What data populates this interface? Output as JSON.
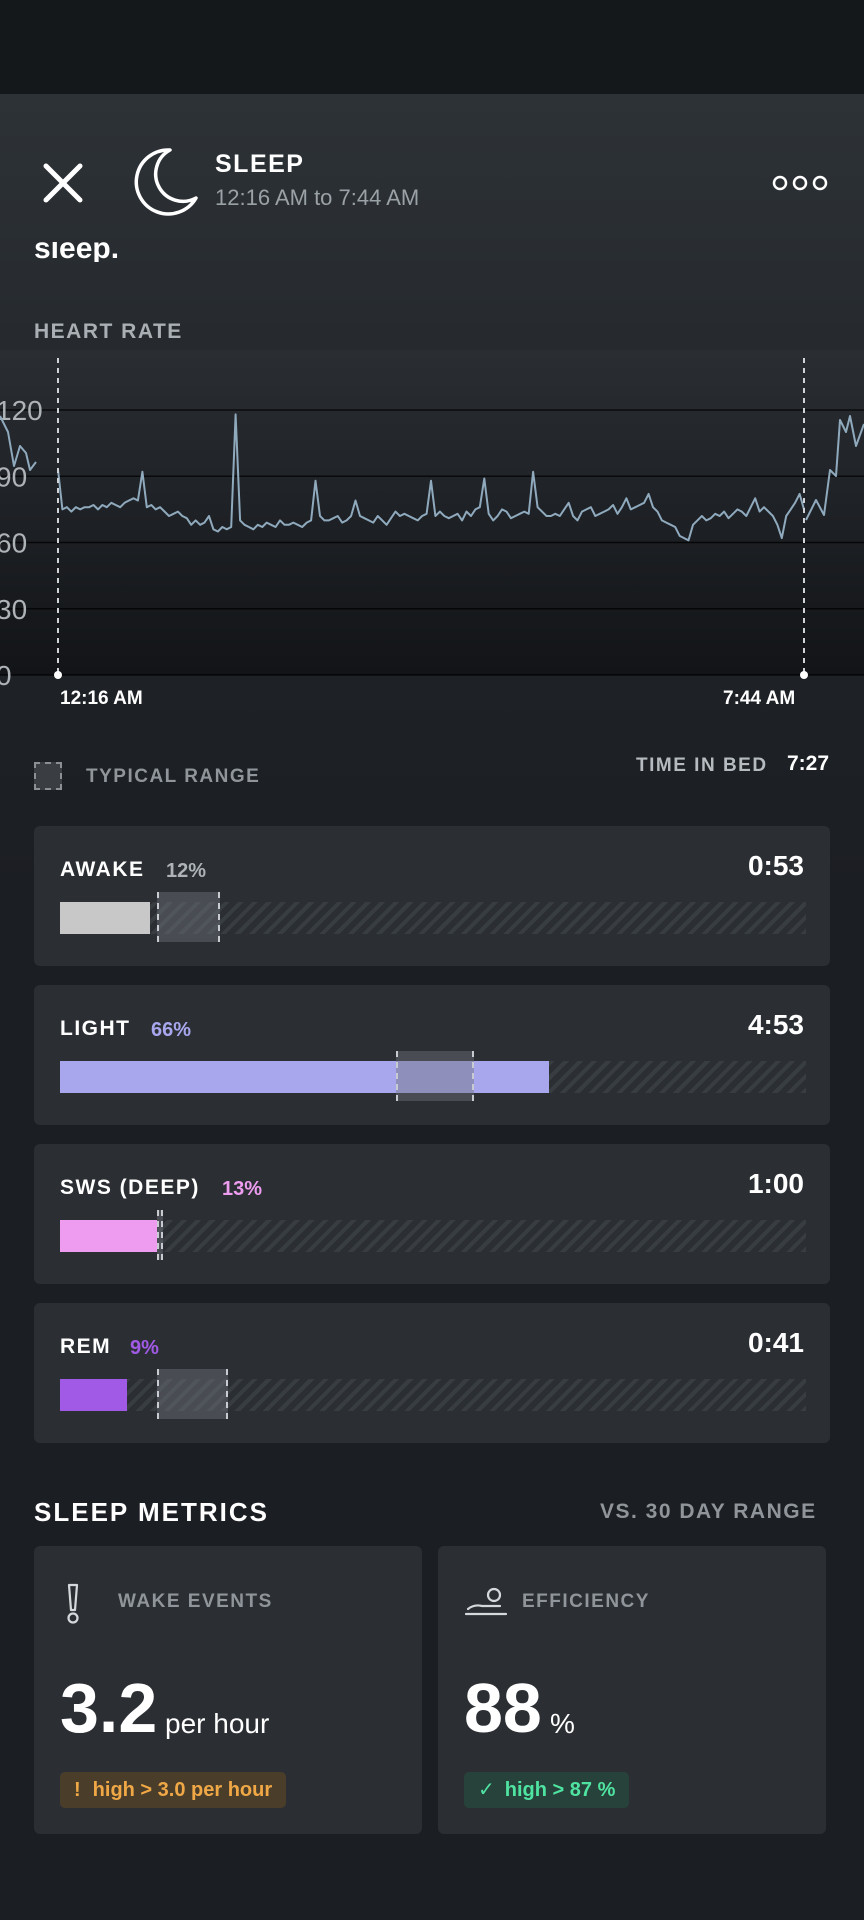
{
  "header": {
    "title": "SLEEP",
    "time_range": "12:16 AM to 7:44 AM",
    "cut_text": "sleep."
  },
  "heart_rate": {
    "label": "HEART RATE",
    "start_label": "12:16 AM",
    "end_label": "7:44 AM"
  },
  "chart_data": {
    "type": "line",
    "ylabel": "",
    "ylim": [
      0,
      120
    ],
    "y_ticks": [
      "0",
      "30",
      "60",
      "90",
      "120"
    ],
    "x_start": "12:16 AM",
    "x_end": "7:44 AM",
    "series": [
      {
        "values": [
          93,
          75,
          76,
          74,
          76,
          75,
          76,
          76,
          77,
          75,
          77,
          76,
          78,
          77,
          76,
          78,
          79,
          80,
          79,
          92,
          76,
          77,
          75,
          76,
          74,
          72,
          73,
          74,
          72,
          71,
          68,
          70,
          68,
          69,
          72,
          66,
          65,
          67,
          66,
          67,
          118,
          70,
          68,
          67,
          66,
          68,
          67,
          69,
          68,
          67,
          70,
          68,
          68,
          69,
          68,
          67,
          69,
          70,
          88,
          72,
          70,
          70,
          71,
          72,
          69,
          70,
          72,
          79,
          72,
          71,
          70,
          69,
          72,
          70,
          68,
          71,
          74,
          72,
          73,
          72,
          71,
          70,
          72,
          73,
          88,
          72,
          74,
          72,
          71,
          72,
          73,
          70,
          74,
          72,
          75,
          76,
          89,
          73,
          70,
          72,
          75,
          74,
          71,
          72,
          73,
          74,
          73,
          92,
          76,
          74,
          72,
          72,
          73,
          72,
          75,
          78,
          72,
          70,
          74,
          75,
          76,
          72,
          73,
          74,
          75,
          77,
          73,
          76,
          80,
          75,
          76,
          77,
          78,
          82,
          76,
          74,
          70,
          69,
          68,
          67,
          63,
          62,
          61,
          68,
          70,
          72,
          70,
          71,
          73,
          72,
          74,
          71,
          73,
          75,
          74,
          72,
          76,
          80,
          74,
          76,
          74,
          72,
          68,
          62,
          72,
          75,
          78,
          82,
          75
        ],
        "color": "#8fa9bd"
      }
    ]
  },
  "legend": {
    "typical_range": "TYPICAL RANGE",
    "time_in_bed_label": "TIME IN BED",
    "time_in_bed_value": "7:27"
  },
  "stages": [
    {
      "name": "AWAKE",
      "pct": "12%",
      "duration": "0:53",
      "color": "#c8c8c8",
      "pct_color": "#aeb3b8",
      "fill_fraction": 0.12,
      "typ_range": [
        0.13,
        0.215
      ]
    },
    {
      "name": "LIGHT",
      "pct": "66%",
      "duration": "4:53",
      "color": "#a8a7ee",
      "pct_color": "#a8a7ee",
      "fill_fraction": 0.655,
      "typ_range": [
        0.45,
        0.555
      ]
    },
    {
      "name": "SWS (DEEP)",
      "pct": "13%",
      "duration": "1:00",
      "color": "#ee9cf0",
      "pct_color": "#ee9cf0",
      "fill_fraction": 0.13,
      "typ_range": [
        0.13,
        0.137
      ]
    },
    {
      "name": "REM",
      "pct": "9%",
      "duration": "0:41",
      "color": "#a05ae6",
      "pct_color": "#a05ae6",
      "fill_fraction": 0.09,
      "typ_range": [
        0.13,
        0.225
      ]
    }
  ],
  "metrics": {
    "title": "SLEEP METRICS",
    "comparison": "VS. 30 DAY RANGE",
    "wake_events": {
      "label": "WAKE EVENTS",
      "value": "3.2",
      "unit": "per hour",
      "badge_icon": "!",
      "badge": "high > 3.0 per hour",
      "icon": "exclamation-icon"
    },
    "efficiency": {
      "label": "EFFICIENCY",
      "value": "88",
      "unit": "%",
      "badge_icon": "✓",
      "badge": "high > 87 %",
      "icon": "bed-sleeper-icon"
    }
  }
}
